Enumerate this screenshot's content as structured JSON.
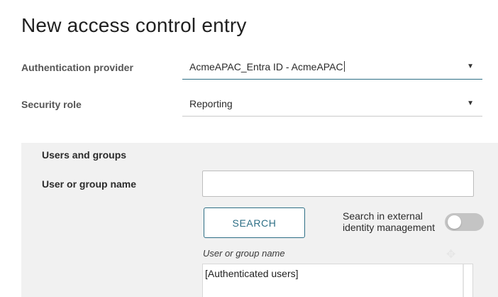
{
  "page": {
    "title": "New access control entry"
  },
  "form": {
    "provider": {
      "label": "Authentication provider",
      "value": "AcmeAPAC_Entra ID - AcmeAPAC"
    },
    "role": {
      "label": "Security role",
      "value": "Reporting"
    },
    "dropdown_icon": "triangle-down-icon",
    "accent_color": "#2e6f86"
  },
  "users_groups": {
    "section_title": "Users and groups",
    "name_label": "User or group name",
    "name_input_value": "",
    "name_input_placeholder": "",
    "search_button_label": "SEARCH",
    "external_search_label": "Search in external identity management",
    "external_search_enabled": false,
    "results_caption": "User or group name",
    "results": [
      "[Authenticated users]"
    ]
  }
}
